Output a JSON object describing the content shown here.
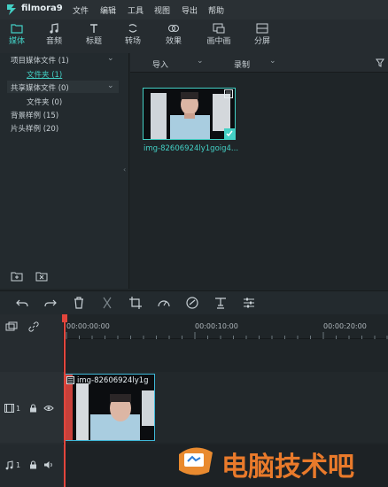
{
  "app": {
    "brand": "filmora9"
  },
  "menu": [
    "文件",
    "编辑",
    "工具",
    "视图",
    "导出",
    "帮助"
  ],
  "tabs": [
    {
      "label": "媒体",
      "icon": "folder-icon",
      "active": true
    },
    {
      "label": "音频",
      "icon": "music-note-icon"
    },
    {
      "label": "标题",
      "icon": "text-title-icon"
    },
    {
      "label": "转场",
      "icon": "transition-icon"
    },
    {
      "label": "效果",
      "icon": "effects-icon"
    },
    {
      "label": "画中画",
      "icon": "picture-in-picture-icon"
    },
    {
      "label": "分屏",
      "icon": "split-screen-icon"
    }
  ],
  "library": {
    "project_media": "项目媒体文件 (1)",
    "project_folder": "文件夹 (1)",
    "shared_media": "共享媒体文件 (0)",
    "shared_folder": "文件夹 (0)",
    "backgrounds": "背景样例 (15)",
    "intros": "片头样例 (20)"
  },
  "media_toolbar": {
    "import": "导入",
    "record": "录制"
  },
  "media_items": [
    {
      "name": "img-82606924ly1goig4..."
    }
  ],
  "timeline": {
    "timecodes": [
      "00:00:00:00",
      "00:00:10:00",
      "00:00:20:00"
    ],
    "video_track_label": "1",
    "audio_track_label": "1",
    "clip_name": "img-82606924ly1g"
  },
  "watermark": "电脑技术吧",
  "colors": {
    "accent": "#43d0c5",
    "playhead": "#e2453c",
    "clip_border": "#3fb8d8"
  }
}
